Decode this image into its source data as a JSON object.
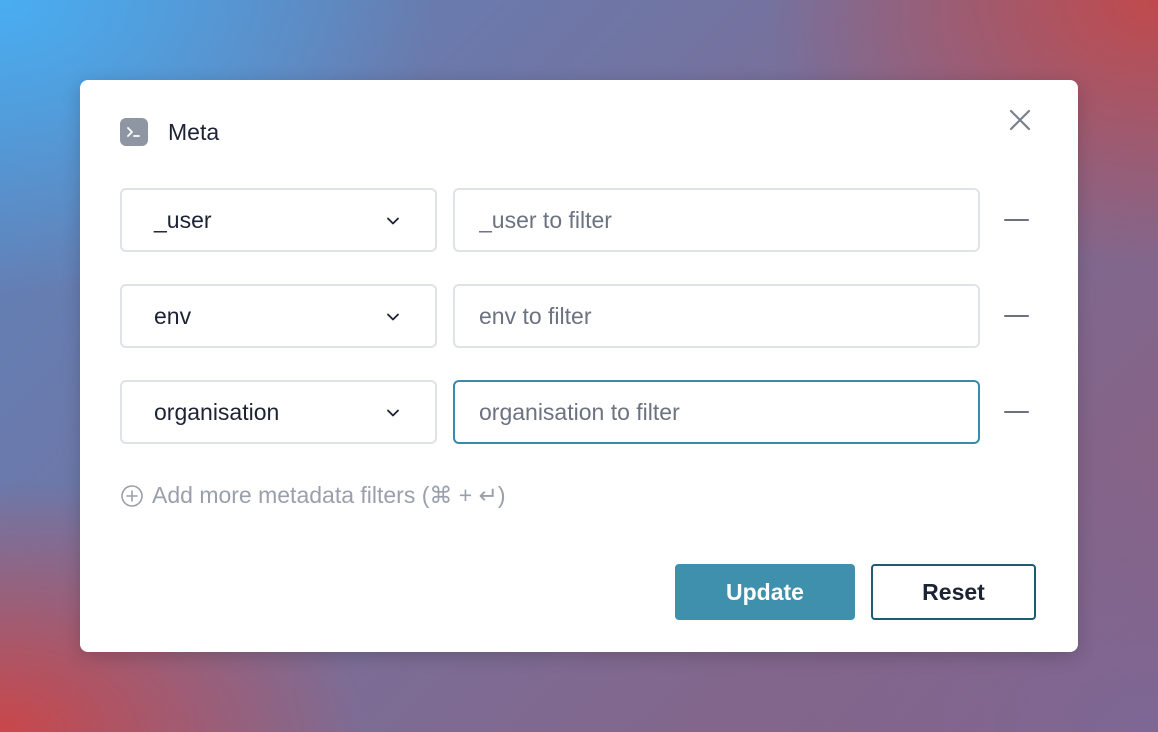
{
  "dialog": {
    "title": "Meta",
    "title_icon": "terminal-icon",
    "close_icon": "close-icon"
  },
  "filters": [
    {
      "key": "_user",
      "value": "",
      "placeholder": "_user to filter",
      "focused": false
    },
    {
      "key": "env",
      "value": "",
      "placeholder": "env to filter",
      "focused": false
    },
    {
      "key": "organisation",
      "value": "",
      "placeholder": "organisation to filter",
      "focused": true
    }
  ],
  "add_more": {
    "label": "Add more metadata filters (⌘ + ↵)",
    "icon": "plus-circle-icon"
  },
  "actions": {
    "update_label": "Update",
    "reset_label": "Reset"
  },
  "colors": {
    "accent": "#3f90ad",
    "focus_border": "#3b8aa8",
    "reset_border": "#1f5b71"
  }
}
